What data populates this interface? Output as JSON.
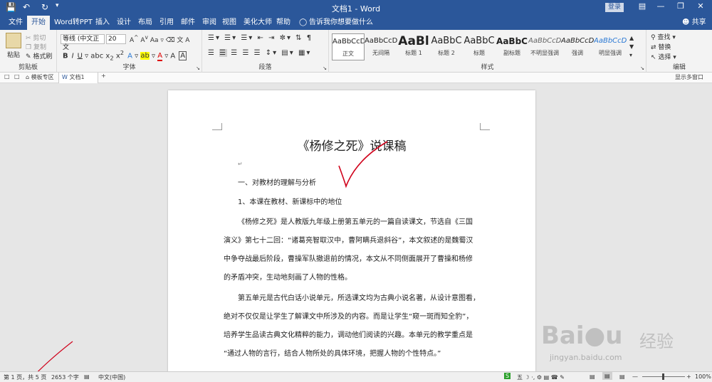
{
  "titlebar": {
    "save_icon": "save-icon",
    "undo_icon": "undo-icon",
    "redo_icon": "redo-icon",
    "title": "文档1 - Word",
    "login": "登录"
  },
  "tabs": [
    "文件",
    "开始",
    "Word转PPT",
    "插入",
    "设计",
    "布局",
    "引用",
    "邮件",
    "审阅",
    "视图",
    "美化大师",
    "帮助",
    "告诉我你想要做什么"
  ],
  "share": "共享",
  "clipboard": {
    "paste": "粘贴",
    "cut": "剪切",
    "copy": "复制",
    "format_painter": "格式刷",
    "label": "剪贴板"
  },
  "font": {
    "name": "等线 (中文正文",
    "size": "20",
    "label": "字体"
  },
  "paragraph": {
    "label": "段落"
  },
  "styles": {
    "items": [
      {
        "preview": "AaBbCcDc",
        "name": "正文"
      },
      {
        "preview": "AaBbCcDc",
        "name": "无间隔"
      },
      {
        "preview": "AaBl",
        "name": "标题 1"
      },
      {
        "preview": "AaBbC",
        "name": "标题 2"
      },
      {
        "preview": "AaBbC",
        "name": "标题"
      },
      {
        "preview": "AaBbC",
        "name": "副标题"
      },
      {
        "preview": "AaBbCcDc",
        "name": "不明显强调"
      },
      {
        "preview": "AaBbCcDc",
        "name": "强调"
      },
      {
        "preview": "AaBbCcDc",
        "name": "明显强调"
      }
    ],
    "label": "样式"
  },
  "editing": {
    "find": "查找",
    "replace": "替换",
    "select": "选择",
    "label": "编辑"
  },
  "doctabs": {
    "template": "模板专区",
    "doc": "文档1",
    "show_windows": "显示多窗口"
  },
  "document": {
    "title": "《杨修之死》说课稿",
    "heading1": "一、对教材的理解与分析",
    "heading2": "1、本课在教材、新课标中的地位",
    "para1": [
      "《杨修之死》是人教版九年级上册第五单元的一篇自读课文，节选自《三国",
      "演义》第七十二回：“诸葛亮智取汉中，曹阿瞒兵退斜谷”，本文叙述的是魏蜀汉",
      "中争夺战最后阶段，曹操军队撤退前的情况，本文从不同侧面展开了曹操和杨修",
      "的矛盾冲突，生动地刻画了人物的性格。"
    ],
    "para2": [
      "第五单元是古代白话小说单元，所选课文均为古典小说名著，从设计意图看，",
      "绝对不仅仅是让学生了解课文中所涉及的内容。而是让学生“窥一斑而知全豹”，",
      "培养学生品读古典文化精粹的能力，调动他们阅读的兴趣。本单元的教学重点是",
      "“通过人物的言行，结合人物所处的具体环境，把握人物的个性特点。”"
    ]
  },
  "status": {
    "page": "第 1 页，共 5 页",
    "words": "2653 个字",
    "lang": "中文(中国)",
    "zoom": "100%"
  },
  "watermark": {
    "brand": "Bai",
    "brand2": "经验",
    "url": "jingyan.baidu.com"
  },
  "colors": {
    "accent": "#2b579a",
    "check": "#d0021b"
  }
}
